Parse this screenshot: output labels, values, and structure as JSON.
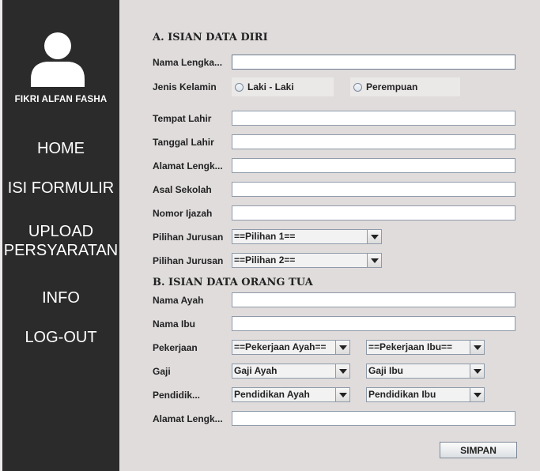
{
  "sidebar": {
    "user_name": "FIKRI ALFAN FASHA",
    "nav": {
      "home": "HOME",
      "isi_formulir": "ISI FORMULIR",
      "upload_line1": "UPLOAD",
      "upload_line2": "PERSYARATAN",
      "info": "INFO",
      "logout": "LOG-OUT"
    }
  },
  "section_a": {
    "title": "A. ISIAN DATA DIRI",
    "nama_label": "Nama Lengka...",
    "jenis_kelamin_label": "Jenis Kelamin",
    "laki_label": "Laki - Laki",
    "perempuan_label": "Perempuan",
    "tempat_lahir_label": "Tempat Lahir",
    "tanggal_lahir_label": "Tanggal Lahir",
    "alamat_label": "Alamat Lengk...",
    "asal_sekolah_label": "Asal Sekolah",
    "nomor_ijazah_label": "Nomor Ijazah",
    "pilihan1_label": "Pilihan Jurusan",
    "pilihan1_value": "==Pilihan 1==",
    "pilihan2_label": "Pilihan Jurusan",
    "pilihan2_value": "==Pilihan 2=="
  },
  "section_b": {
    "title": "B. ISIAN DATA ORANG TUA",
    "nama_ayah_label": "Nama Ayah",
    "nama_ibu_label": "Nama Ibu",
    "pekerjaan_label": "Pekerjaan",
    "pekerjaan_ayah_value": "==Pekerjaan Ayah==",
    "pekerjaan_ibu_value": "==Pekerjaan Ibu==",
    "gaji_label": "Gaji",
    "gaji_ayah_value": "Gaji Ayah",
    "gaji_ibu_value": "Gaji Ibu",
    "pendidikan_label": "Pendidik...",
    "pendidikan_ayah_value": "Pendidikan Ayah",
    "pendidikan_ibu_value": "Pendidikan Ibu",
    "alamat_label": "Alamat Lengk..."
  },
  "actions": {
    "simpan_label": "SIMPAN"
  }
}
